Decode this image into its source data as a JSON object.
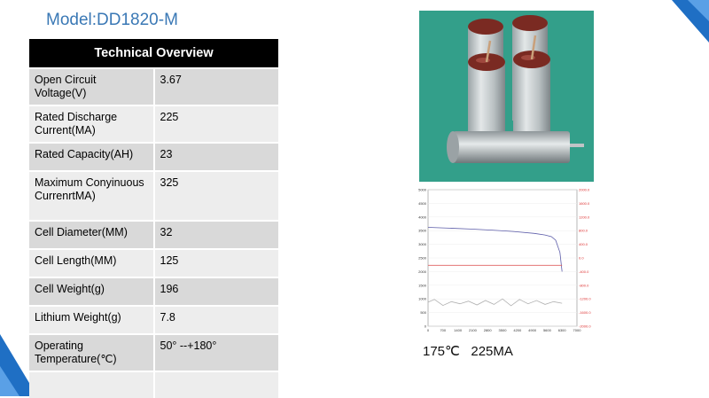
{
  "title": "Model:DD1820-M",
  "table": {
    "header": "Technical  Overview",
    "rows": [
      {
        "label": "Open Circuit Voltage(V)",
        "value": "3.67"
      },
      {
        "label": "Rated Discharge Current(MA)",
        "value": "225"
      },
      {
        "label": "Rated Capacity(AH)",
        "value": "23"
      },
      {
        "label": "Maximum Conyinuous CurrenrtMA)",
        "value": "325"
      },
      {
        "label": "Cell Diameter(MM)",
        "value": "32"
      },
      {
        "label": "Cell Length(MM)",
        "value": "125"
      },
      {
        "label": "Cell Weight(g)",
        "value": "196"
      },
      {
        "label": "Lithium Weight(g)",
        "value": "7.8"
      },
      {
        "label": "Operating Temperature(℃)",
        "value": "50°  --+180°"
      },
      {
        "label": "",
        "value": ""
      }
    ]
  },
  "caption": "175℃   225MA",
  "colors": {
    "title": "#3a78b5",
    "header_bg": "#000000",
    "row_dark": "#d9d9d9",
    "row_light": "#ededed",
    "accent": "#1f6fc4"
  },
  "chart_data": {
    "type": "line",
    "x_ticks": [
      "0",
      "700",
      "1400",
      "2100",
      "2800",
      "3500",
      "4200",
      "4900",
      "5600",
      "6300",
      "7000"
    ],
    "y_left_ticks": [
      "5000",
      "4500",
      "4000",
      "3500",
      "3000",
      "2500",
      "2000",
      "1500",
      "1000",
      "500",
      "0"
    ],
    "y_right_ticks": [
      "2000.0",
      "1600.0",
      "1200.0",
      "800.0",
      "400.0",
      "0.0",
      "-400.0",
      "-800.0",
      "-1200.0",
      "-1600.0",
      "-2000.0"
    ],
    "xlim": [
      0,
      7000
    ],
    "ylim": [
      0,
      5000
    ],
    "series": [
      {
        "color": "#5b5ba8",
        "x": [
          0,
          1000,
          2000,
          3000,
          4000,
          5000,
          5500,
          5800,
          6000,
          6200,
          6300
        ],
        "y": [
          3620,
          3590,
          3560,
          3520,
          3470,
          3400,
          3340,
          3280,
          3150,
          2700,
          2000
        ]
      },
      {
        "color": "#e06060",
        "x": [
          0,
          6300
        ],
        "y": [
          2230,
          2230
        ]
      },
      {
        "color": "#b0b0b0",
        "x": [
          0,
          300,
          700,
          1100,
          1500,
          1900,
          2300,
          2700,
          3100,
          3500,
          3900,
          4300,
          4700,
          5100,
          5500,
          5900,
          6300
        ],
        "y": [
          880,
          980,
          760,
          900,
          820,
          920,
          780,
          940,
          800,
          1000,
          750,
          980,
          820,
          940,
          800,
          900,
          840
        ]
      }
    ]
  }
}
